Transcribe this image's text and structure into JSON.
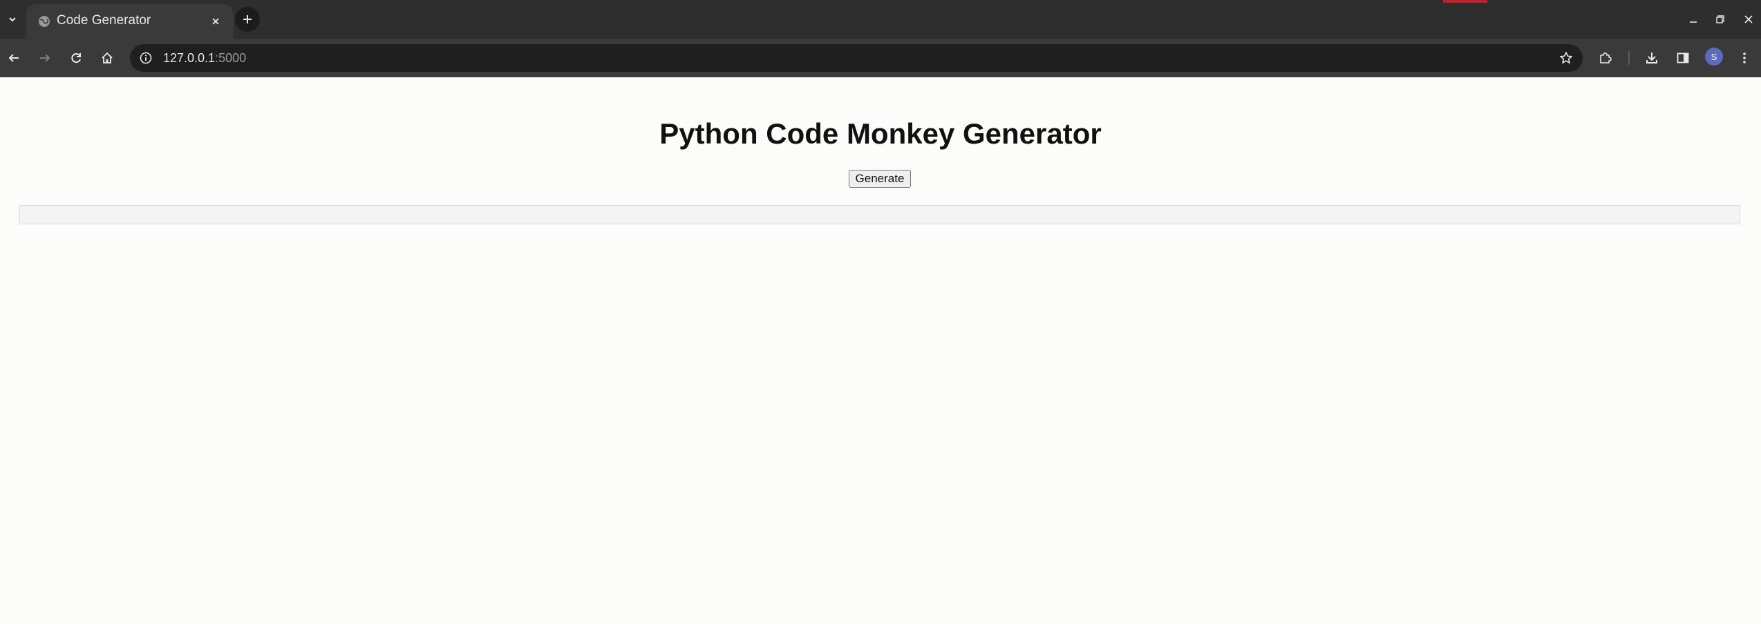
{
  "browser": {
    "tab": {
      "title": "Code Generator"
    },
    "address_bar": {
      "host": "127.0.0.1",
      "port": ":5000"
    },
    "profile_initial": "S",
    "icons": {
      "tab_search": "chevron-down-icon",
      "favicon": "globe-icon",
      "tab_close": "close-icon",
      "new_tab": "plus-icon",
      "back": "arrow-left-icon",
      "forward": "arrow-right-icon",
      "reload": "reload-icon",
      "home": "home-icon",
      "site_info": "info-icon",
      "bookmark": "star-icon",
      "extensions": "puzzle-icon",
      "downloads": "download-icon",
      "side_panel": "side-panel-icon",
      "menu": "kebab-menu-icon"
    }
  },
  "page": {
    "heading": "Python Code Monkey Generator",
    "generate_label": "Generate",
    "output": ""
  },
  "colors": {
    "page_background": "#fcfcfa",
    "chrome_dark": "#2e2e2e",
    "toolbar": "#3a3a3a",
    "avatar": "#5c6bc0"
  }
}
